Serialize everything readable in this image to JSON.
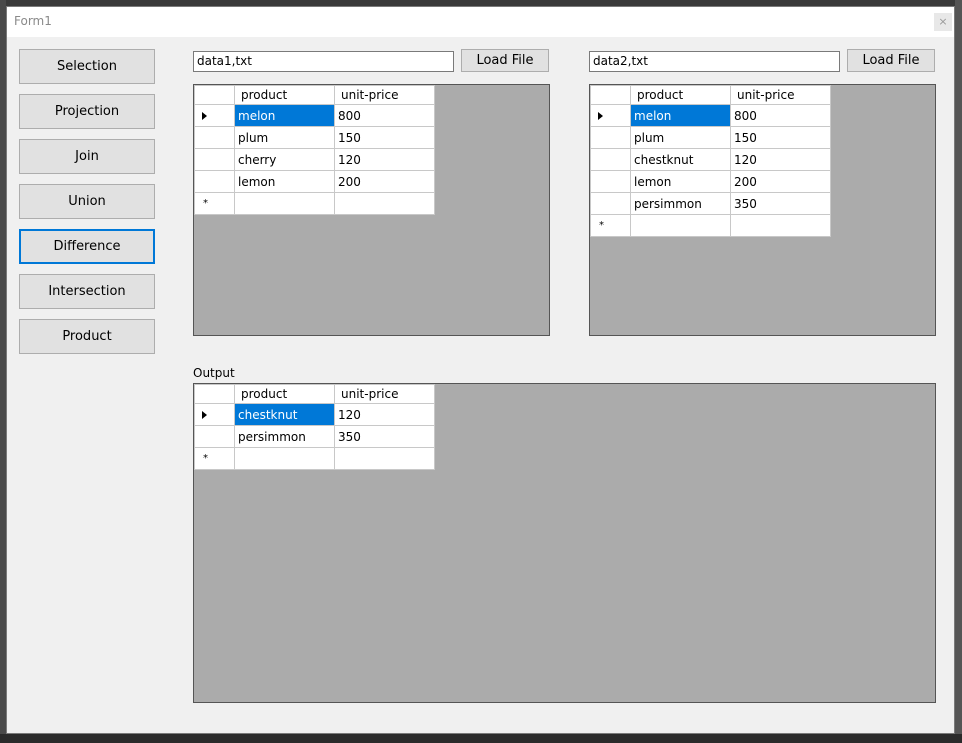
{
  "window": {
    "title": "Form1",
    "close_glyph": "×"
  },
  "operations": [
    {
      "label": "Selection",
      "active": false
    },
    {
      "label": "Projection",
      "active": false
    },
    {
      "label": "Join",
      "active": false
    },
    {
      "label": "Union",
      "active": false
    },
    {
      "label": "Difference",
      "active": true
    },
    {
      "label": "Intersection",
      "active": false
    },
    {
      "label": "Product",
      "active": false
    }
  ],
  "data1": {
    "file_value": "data1,txt",
    "load_label": "Load File",
    "columns": [
      "product",
      "unit-price"
    ],
    "rows": [
      [
        "melon",
        "800"
      ],
      [
        "plum",
        "150"
      ],
      [
        "cherry",
        "120"
      ],
      [
        "lemon",
        "200"
      ]
    ]
  },
  "data2": {
    "file_value": "data2,txt",
    "load_label": "Load File",
    "columns": [
      "product",
      "unit-price"
    ],
    "rows": [
      [
        "melon",
        "800"
      ],
      [
        "plum",
        "150"
      ],
      [
        "chestknut",
        "120"
      ],
      [
        "lemon",
        "200"
      ],
      [
        "persimmon",
        "350"
      ]
    ]
  },
  "output": {
    "label": "Output",
    "columns": [
      "product",
      "unit-price"
    ],
    "rows": [
      [
        "chestknut",
        "120"
      ],
      [
        "persimmon",
        "350"
      ]
    ]
  },
  "new_row_marker": "*"
}
